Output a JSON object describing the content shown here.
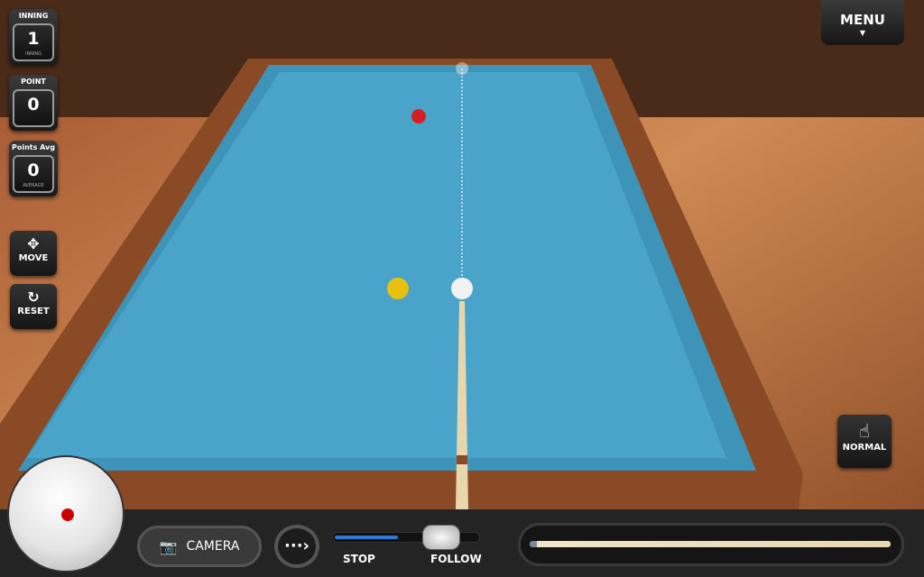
{
  "scoreboard": [
    {
      "label": "INNING",
      "value": "1",
      "sub": "INNING"
    },
    {
      "label": "POINT",
      "value": "0",
      "sub": ""
    },
    {
      "label": "Points Avg",
      "value": "0",
      "sub": "AVERAGE"
    }
  ],
  "controls": {
    "move": "MOVE",
    "reset": "RESET",
    "menu": "MENU",
    "mode": "NORMAL",
    "camera": "CAMERA",
    "slider_left": "STOP",
    "slider_right": "FOLLOW"
  },
  "spin_slider_value": 0.44,
  "icons": {
    "move": "move-arrows-icon",
    "reset": "rotate-icon",
    "menu": "caret-down-icon",
    "mode": "tap-hand-icon",
    "camera": "camera-icon",
    "next": "dotted-arrow-icon"
  },
  "colors": {
    "cloth": "#4aa3c9",
    "rail": "#8a4a25",
    "slider_fill": "#2c7ad6",
    "target_dot": "#cc0000"
  }
}
